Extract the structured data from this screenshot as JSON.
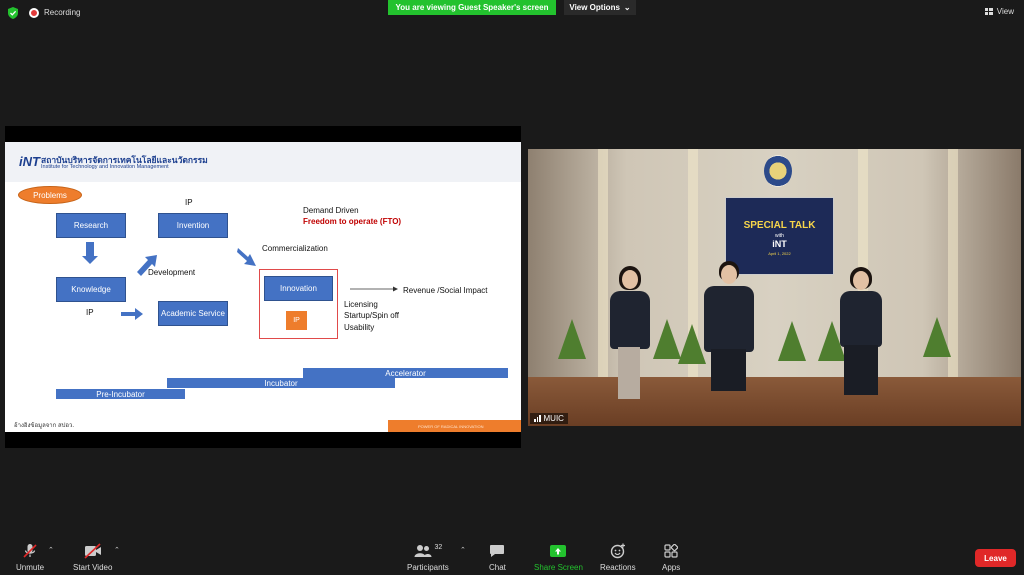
{
  "topbar": {
    "recording_label": "Recording",
    "viewing_banner": "You are viewing Guest Speaker's screen",
    "view_options_label": "View Options",
    "view_label": "View"
  },
  "slide": {
    "logo": "iNT",
    "institute_thai": "สถาบันบริหารจัดการเทคโนโลยีและนวัตกรรม",
    "institute_en": "Institute for Technology and Innovation Management",
    "problems": "Problems",
    "research": "Research",
    "knowledge": "Knowledge",
    "invention": "Invention",
    "academic_service": "Academic Service",
    "innovation": "Innovation",
    "ip_box": "IP",
    "ip_top": "IP",
    "ip_left": "IP",
    "development": "Development",
    "commercialization": "Commercialization",
    "demand_driven": "Demand Driven",
    "fto": "Freedom to operate (FTO)",
    "revenue": "Revenue /Social Impact",
    "licensing": "Licensing",
    "startup": "Startup/Spin off",
    "usability": "Usability",
    "accelerator": "Accelerator",
    "incubator": "Incubator",
    "pre_incubator": "Pre-Incubator",
    "footer_note": "อ้างอิงข้อมูลจาก สปอว.",
    "footer_strip": "POWER OF RADICAL INNOVATION"
  },
  "video": {
    "participant_name": "MUIC",
    "banner_title": "SPECIAL TALK",
    "banner_with": "with",
    "banner_int": "iNT",
    "banner_date": "April 1, 2022"
  },
  "toolbar": {
    "unmute": "Unmute",
    "start_video": "Start Video",
    "participants": "Participants",
    "participants_count": "32",
    "chat": "Chat",
    "share_screen": "Share Screen",
    "reactions": "Reactions",
    "apps": "Apps",
    "leave": "Leave"
  },
  "colors": {
    "share_green": "#23c22e",
    "leave_red": "#e02828",
    "slide_blue": "#4472c4",
    "slide_orange": "#ee7d2c"
  },
  "icons": [
    "shield-icon",
    "record-icon",
    "chevron-down-icon",
    "grid-icon",
    "mic-muted-icon",
    "video-off-icon",
    "participants-icon",
    "chat-icon",
    "share-screen-icon",
    "reactions-icon",
    "apps-icon",
    "signal-icon"
  ]
}
